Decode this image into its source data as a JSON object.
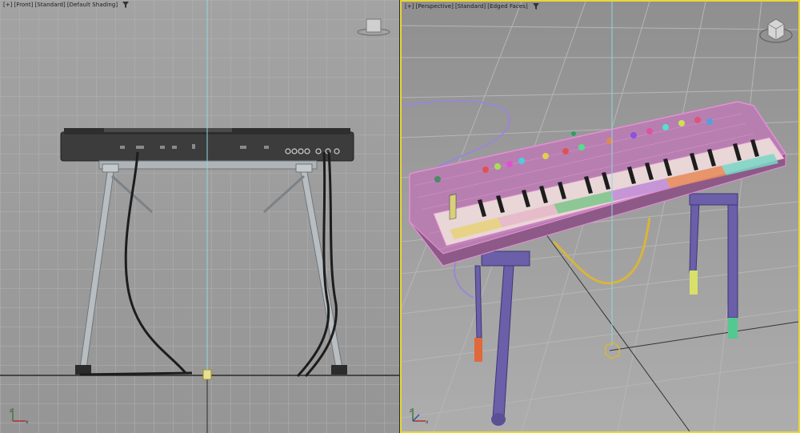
{
  "viewports": {
    "front": {
      "labels": [
        "[+]",
        "[Front]",
        "[Standard]",
        "[Default Shading]"
      ],
      "filter_icon": "filter-icon",
      "cube_icon": "view-cube-icon",
      "axis_icon": "axis-tripod-icon"
    },
    "perspective": {
      "labels": [
        "[+]",
        "[Perspective]",
        "[Standard]",
        "[Edged Faces]"
      ],
      "filter_icon": "filter-icon",
      "cube_icon": "view-cube-icon",
      "axis_icon": "axis-tripod-icon",
      "active_border_color": "#e8d63a"
    }
  },
  "colors": {
    "front_bg": "#a0a0a0",
    "perspective_bg": "#9c9c9c",
    "grid_line": "#b4b4b4",
    "wire_pink": "#e78fd8",
    "stand_purple": "#6a5fa8",
    "cable_yellow": "#d9b53b",
    "cable_purple": "#9a86d6",
    "pivot_cyan": "#8fd8e0"
  }
}
